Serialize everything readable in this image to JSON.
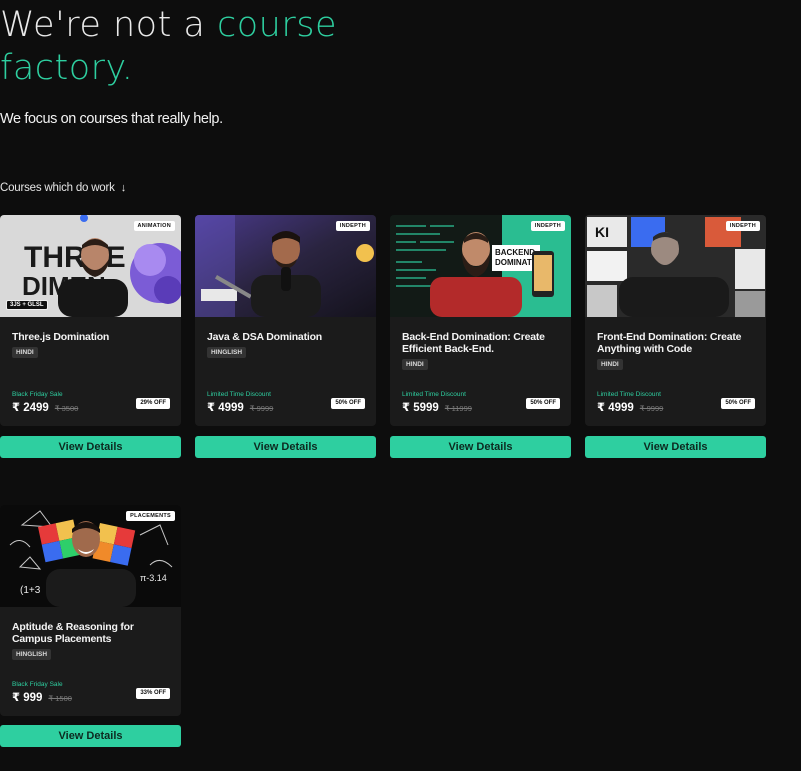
{
  "hero": {
    "title_part1": "We're not a ",
    "title_accent1": "course",
    "title_accent2": "factory.",
    "subtitle": "We focus on courses that really help."
  },
  "section": {
    "label": "Courses which do work",
    "arrow_icon": "arrow-down-icon"
  },
  "colors": {
    "accent": "#2ecfa0",
    "background": "#0d0d0d",
    "card": "#1b1b1b"
  },
  "courses": [
    {
      "tag": "ANIMATION",
      "thumb_badge": "3JS + GLSL",
      "title": "Three.js Domination",
      "language": "HINDI",
      "sale_label": "Black Friday Sale",
      "price": "₹ 2499",
      "old_price": "₹ 3500",
      "discount": "29% OFF",
      "button": "View Details"
    },
    {
      "tag": "INDEPTH",
      "title": "Java & DSA Domination",
      "language": "HINGLISH",
      "sale_label": "Limited Time Discount",
      "price": "₹ 4999",
      "old_price": "₹ 9999",
      "discount": "50% OFF",
      "button": "View Details"
    },
    {
      "tag": "INDEPTH",
      "title": "Back-End Domination: Create Efficient Back-End.",
      "language": "HINDI",
      "sale_label": "Limited Time Discount",
      "price": "₹ 5999",
      "old_price": "₹ 11999",
      "discount": "50% OFF",
      "button": "View Details"
    },
    {
      "tag": "INDEPTH",
      "title": "Front-End Domination: Create Anything with Code",
      "language": "HINDI",
      "sale_label": "Limited Time Discount",
      "price": "₹ 4999",
      "old_price": "₹ 9999",
      "discount": "50% OFF",
      "button": "View Details"
    },
    {
      "tag": "PLACEMENTS",
      "title": "Aptitude & Reasoning for Campus Placements",
      "language": "HINGLISH",
      "sale_label": "Black Friday Sale",
      "price": "₹ 999",
      "old_price": "₹ 1500",
      "discount": "33% OFF",
      "button": "View Details"
    }
  ]
}
